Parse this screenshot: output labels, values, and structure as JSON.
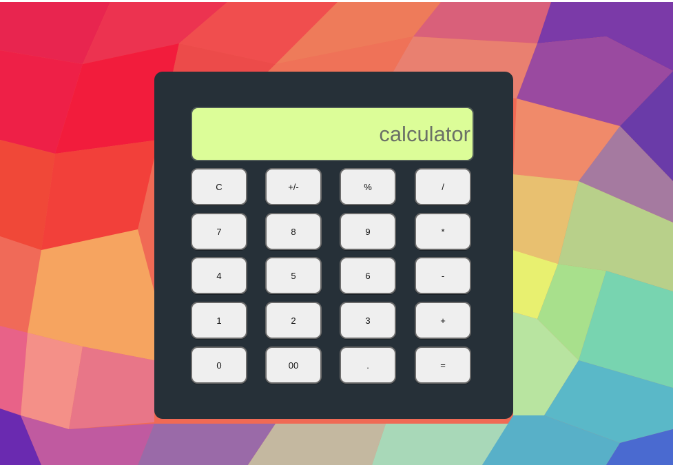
{
  "display": {
    "text": "calculator"
  },
  "colors": {
    "panel": "#263038",
    "display_bg": "#dcfd98",
    "display_text": "#6b7167",
    "button_bg": "#efefef"
  },
  "keys": {
    "row1": [
      "C",
      "+/-",
      "%",
      "/"
    ],
    "row2": [
      "7",
      "8",
      "9",
      "*"
    ],
    "row3": [
      "4",
      "5",
      "6",
      "-"
    ],
    "row4": [
      "1",
      "2",
      "3",
      "+"
    ],
    "row5": [
      "0",
      "00",
      ".",
      "="
    ]
  }
}
